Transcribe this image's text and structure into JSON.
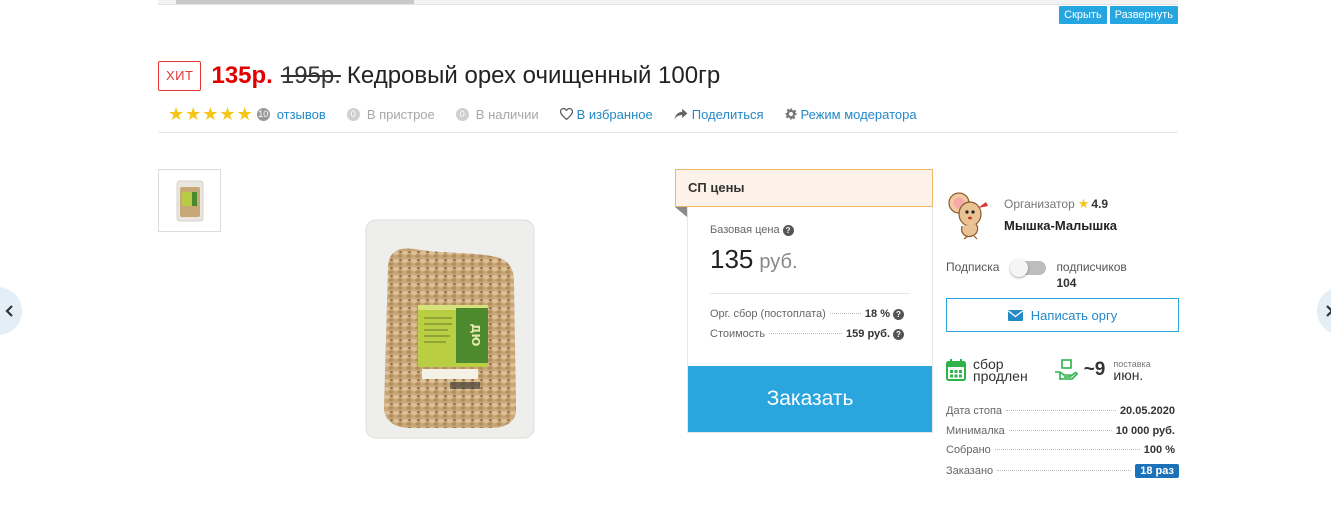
{
  "top_actions": {
    "hide_label": "Скрыть",
    "expand_label": "Развернуть"
  },
  "product": {
    "badge": "ХИТ",
    "price_new": "135р.",
    "price_old": "195р.",
    "name": "Кедровый орех очищенный 100гр"
  },
  "meta": {
    "rating_stars": 5,
    "reviews_count": "10",
    "reviews_label": "отзывов",
    "attach_count": "0",
    "attach_label": "В пристрое",
    "stock_count": "0",
    "stock_label": "В наличии",
    "favorite_label": "В избранное",
    "share_label": "Поделиться",
    "moderator_label": "Режим модератора"
  },
  "sp": {
    "header": "СП цены",
    "base_label": "Базовая цена",
    "base_price": "135",
    "base_currency": "руб.",
    "fee_label": "Орг. сбор (постоплата)",
    "fee_value": "18 %",
    "cost_label": "Стоимость",
    "cost_value": "159 руб.",
    "order_label": "Заказать"
  },
  "organizer": {
    "label": "Организатор",
    "rating": "4.9",
    "name": "Мышка-Малышка",
    "subscribe_label": "Подписка",
    "subscribed": false,
    "subscribers_label": "подписчиков",
    "subscribers_count": "104",
    "write_label": "Написать оргу"
  },
  "status": {
    "collect_line1": "сбор",
    "collect_line2": "продлен",
    "delivery_value": "~9",
    "delivery_small": "поставка",
    "delivery_month": "июн."
  },
  "stats": {
    "stop_date_label": "Дата стопа",
    "stop_date": "20.05.2020",
    "minimum_label": "Минималка",
    "minimum": "10 000 руб.",
    "collected_label": "Собрано",
    "collected": "100 %",
    "ordered_label": "Заказано",
    "ordered": "18 раз"
  },
  "colors": {
    "accent": "#2aa5de",
    "link": "#2389c7",
    "price_red": "#e00000",
    "star": "#f5c518",
    "badge_blue": "#1c72b8",
    "calendar_green": "#2db34a"
  },
  "icons": [
    "star-icon",
    "heart-icon",
    "share-icon",
    "gear-icon",
    "help-icon",
    "envelope-icon",
    "calendar-icon",
    "delivery-hand-icon",
    "chevron-left-icon",
    "chevron-right-icon"
  ]
}
